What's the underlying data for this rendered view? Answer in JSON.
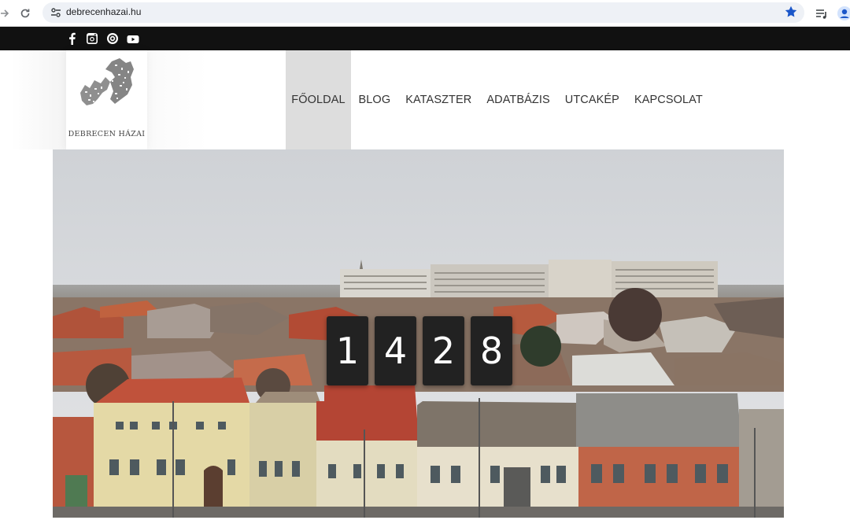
{
  "browser": {
    "url": "debrecenhazai.hu",
    "icons": [
      "forward-icon",
      "reload-icon",
      "site-info-icon",
      "bookmark-star-icon",
      "media-queue-icon",
      "profile-icon"
    ],
    "accent": "#1a73e8"
  },
  "social": {
    "items": [
      "facebook-icon",
      "instagram-icon",
      "target-icon",
      "youtube-icon"
    ],
    "bar_color": "#111111"
  },
  "header": {
    "logo_text": "DEBRECEN HÁZAI",
    "menu": [
      {
        "label": "FŐOLDAL",
        "active": true
      },
      {
        "label": "BLOG"
      },
      {
        "label": "KATASZTER"
      },
      {
        "label": "ADATBÁZIS"
      },
      {
        "label": "UTCAKÉP"
      },
      {
        "label": "KAPCSOLAT"
      }
    ]
  },
  "hero": {
    "counter_digits": [
      "1",
      "4",
      "2",
      "8"
    ]
  }
}
